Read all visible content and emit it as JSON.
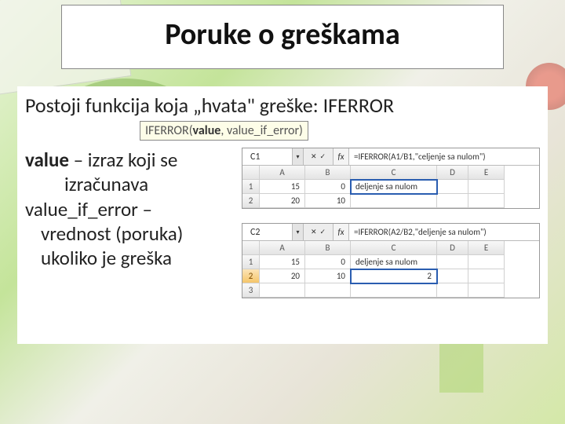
{
  "title": "Poruke o greškama",
  "intro": "Postoji funkcija koja „hvata\" greške: IFERROR",
  "syntax": {
    "prefix": "IFERROR(",
    "arg1_bold": "value",
    "rest": ", value_if_error)"
  },
  "desc": {
    "value_label": "value",
    "value_rest": " – izraz koji se",
    "value_line2": "izračunava",
    "vie_label": "value_if_error –",
    "vie_line1": "vrednost (poruka)",
    "vie_line2": "ukoliko je greška"
  },
  "fx": {
    "label": "fx",
    "dropdown_glyph": "▾",
    "btn1": "✕",
    "btn2": "✓"
  },
  "shot1": {
    "namebox": "C1",
    "formula": "=IFERROR(A1/B1,\"celjenje sa nulom\")",
    "cols": [
      "",
      "A",
      "B",
      "C",
      "D",
      "E"
    ],
    "rows": [
      {
        "r": "1",
        "a": "15",
        "b": "0",
        "c": "deljenje sa nulom",
        "sel": true
      },
      {
        "r": "2",
        "a": "20",
        "b": "10",
        "c": "",
        "sel": false
      }
    ]
  },
  "shot2": {
    "namebox": "C2",
    "formula": "=IFERROR(A2/B2,\"deljenje sa nulom\")",
    "cols": [
      "",
      "A",
      "B",
      "C",
      "D",
      "E"
    ],
    "rows": [
      {
        "r": "1",
        "a": "15",
        "b": "0",
        "c": "deljenje sa nulom",
        "sel": false
      },
      {
        "r": "2",
        "a": "20",
        "b": "10",
        "c": "2",
        "sel": true
      },
      {
        "r": "3",
        "a": "",
        "b": "",
        "c": "",
        "sel": false
      }
    ]
  }
}
